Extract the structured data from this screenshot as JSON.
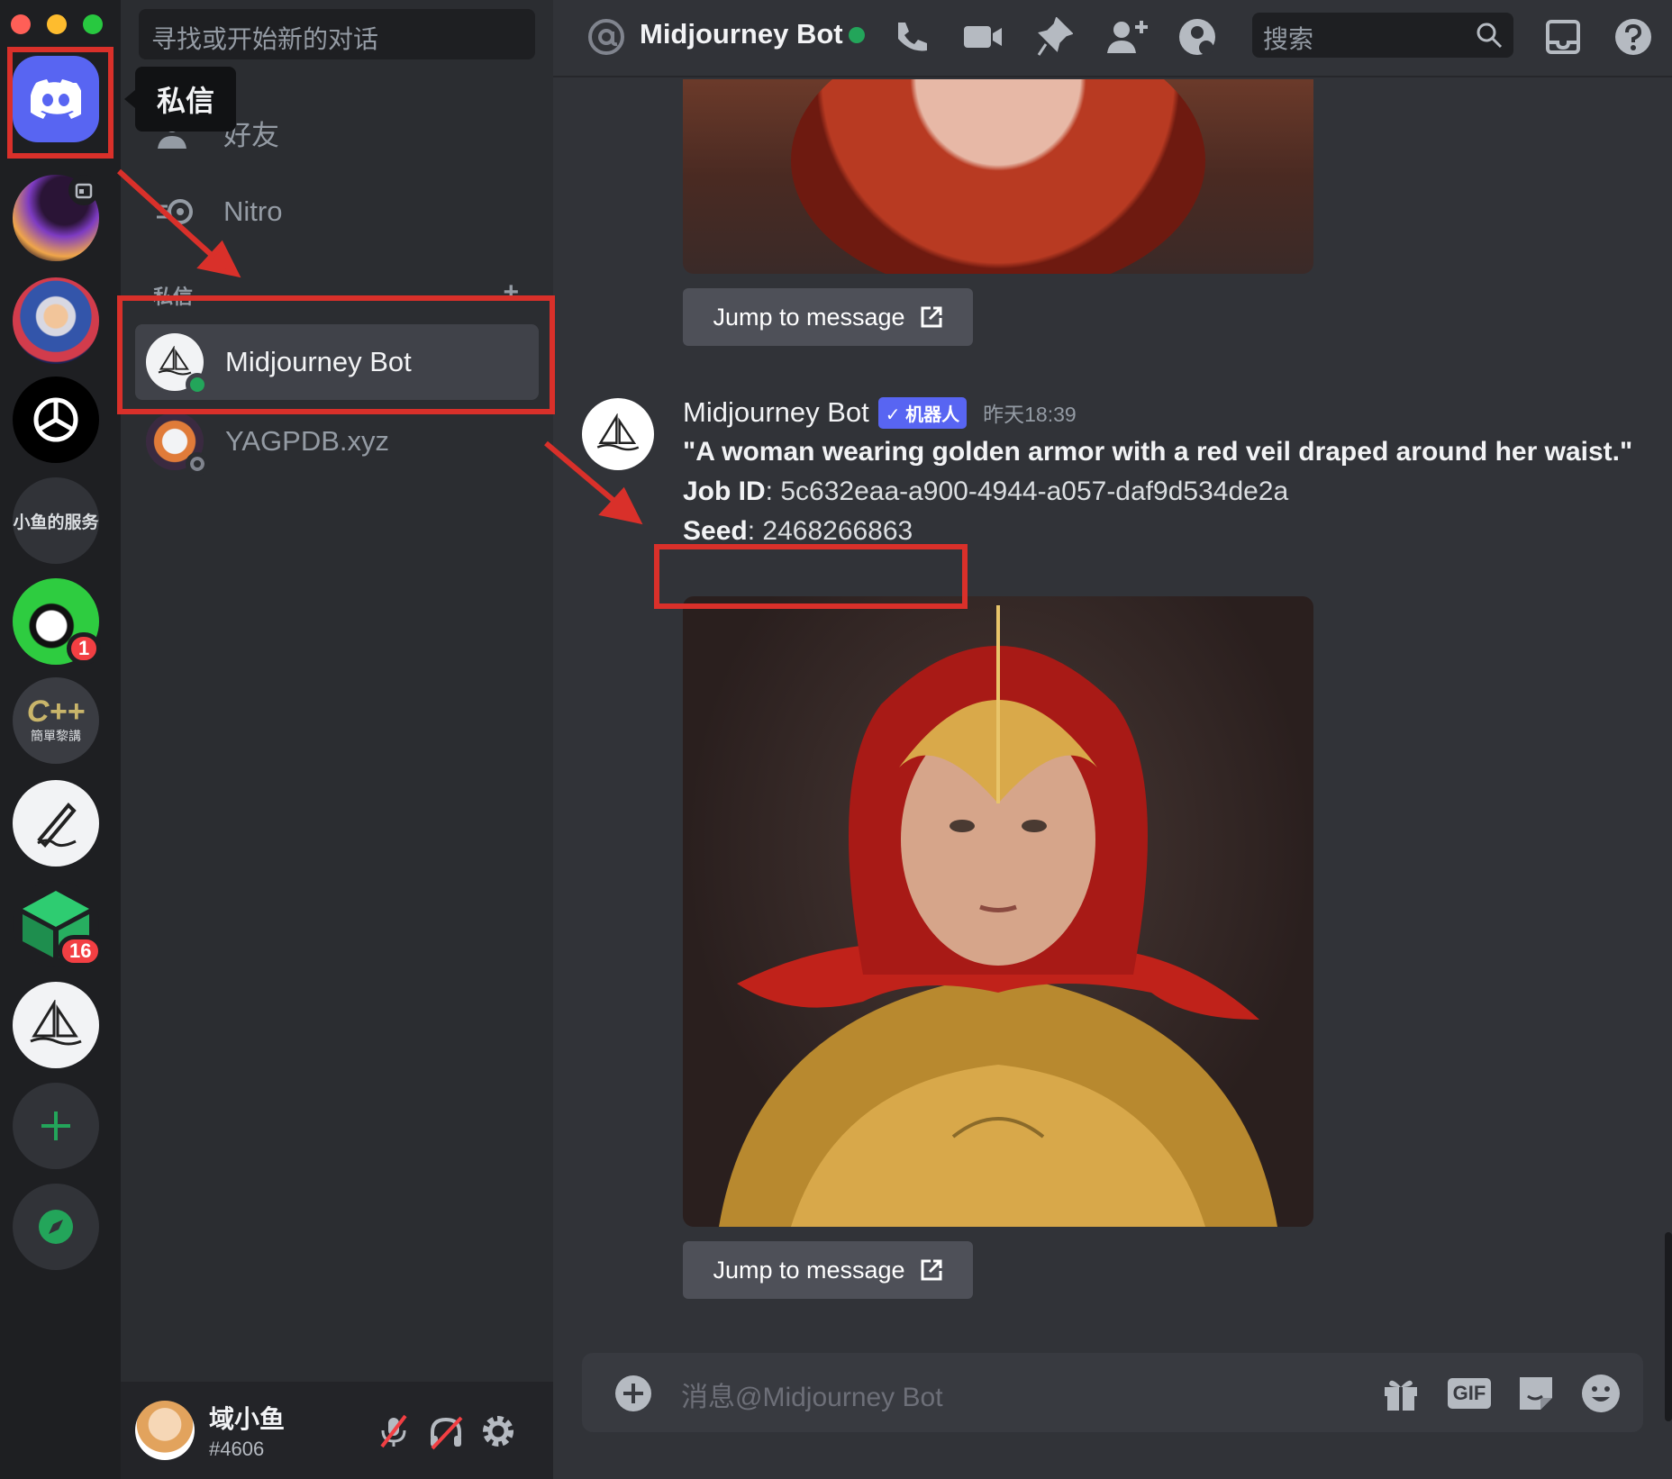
{
  "colors": {
    "accent": "#5865f2",
    "online": "#23a55a",
    "notification": "#f23f43",
    "annotation": "#d9302a"
  },
  "rail": {
    "home_tooltip": "私信",
    "servers": [
      {
        "name": "home",
        "icon": "discord-logo-icon"
      },
      {
        "name": "nebula-server",
        "icon": "server-avatar-icon",
        "has_event": true
      },
      {
        "name": "wizard-server",
        "icon": "server-avatar-icon"
      },
      {
        "name": "openai-server",
        "icon": "openai-logo-icon"
      },
      {
        "name": "text-server",
        "label": "小鱼的服务"
      },
      {
        "name": "cartoon-server",
        "icon": "server-avatar-icon",
        "badge": "1"
      },
      {
        "name": "cpp-server",
        "label": "C++",
        "sublabel": "簡單黎講"
      },
      {
        "name": "pen-server",
        "icon": "pen-icon"
      },
      {
        "name": "cube-server",
        "icon": "cube-logo-icon",
        "badge": "16"
      },
      {
        "name": "midjourney-server",
        "icon": "sailboat-icon"
      }
    ]
  },
  "dm_sidebar": {
    "search_placeholder": "寻找或开始新的对话",
    "nav": [
      {
        "label": "好友",
        "icon": "friends-icon"
      },
      {
        "label": "Nitro",
        "icon": "nitro-icon"
      }
    ],
    "section_title": "私信",
    "section_add": "+",
    "dms": [
      {
        "name": "Midjourney Bot",
        "status": "online",
        "selected": true
      },
      {
        "name": "YAGPDB.xyz",
        "status": "offline",
        "selected": false
      }
    ]
  },
  "user_panel": {
    "username": "域小鱼",
    "discriminator": "#4606"
  },
  "topbar": {
    "channel_name": "Midjourney Bot",
    "search_placeholder": "搜索"
  },
  "chat": {
    "jump_label": "Jump to message",
    "message": {
      "author": "Midjourney Bot",
      "bot_tag": "✓ 机器人",
      "timestamp": "昨天18:39",
      "prompt": "\"A woman wearing golden armor with a red veil draped around her waist.\"",
      "job_label": "Job ID",
      "job_id": "5c632eaa-a900-4944-a057-daf9d534de2a",
      "seed_label": "Seed",
      "seed": "2468266863"
    },
    "composer_placeholder": "消息@Midjourney Bot",
    "composer_gif": "GIF"
  }
}
